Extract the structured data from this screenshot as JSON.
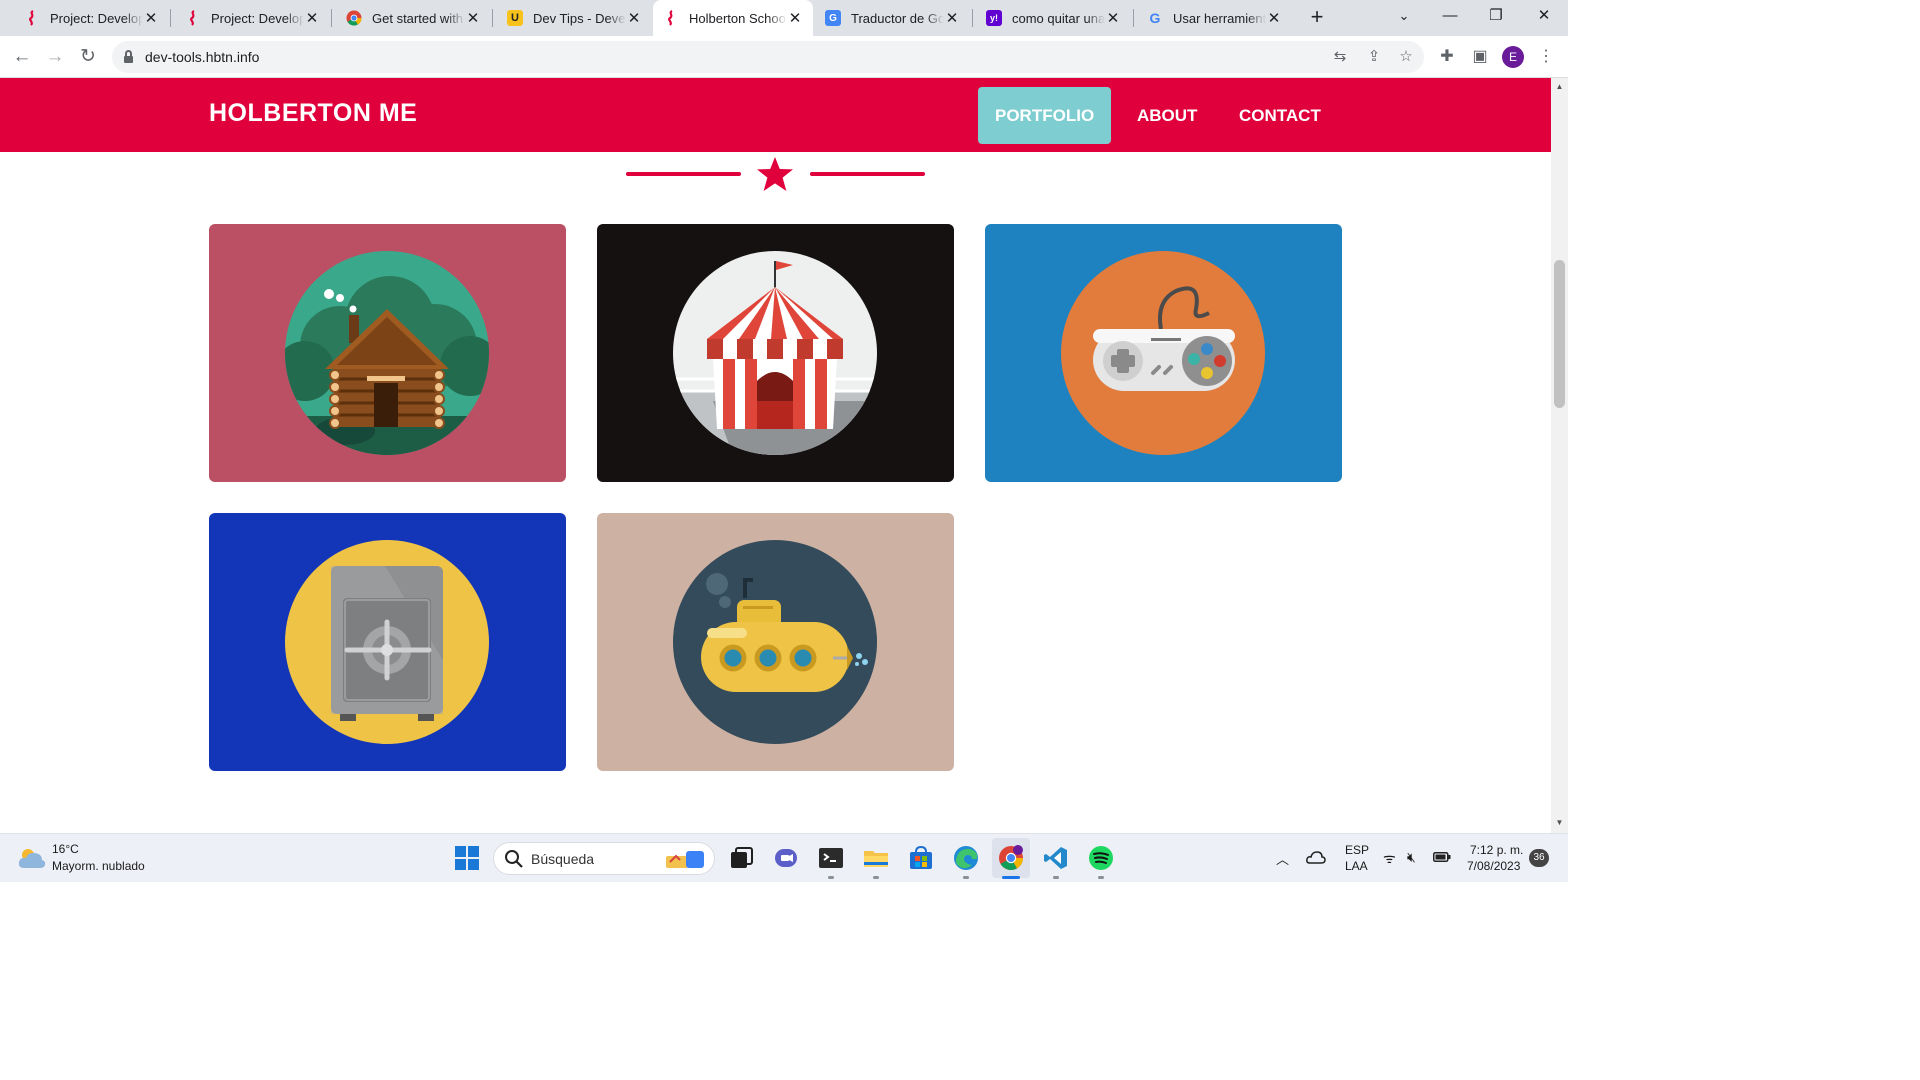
{
  "browser": {
    "tabs": [
      {
        "title": "Project: Developer tools",
        "favicon": "holberton-icon",
        "active": false
      },
      {
        "title": "Project: Developer tools",
        "favicon": "holberton-icon",
        "active": false
      },
      {
        "title": "Get started with viewing",
        "favicon": "chrome-icon",
        "active": false
      },
      {
        "title": "Dev Tips - Developer",
        "favicon": "dev-tips-icon",
        "active": false
      },
      {
        "title": "Holberton School",
        "favicon": "holberton-icon",
        "active": true
      },
      {
        "title": "Traductor de Google",
        "favicon": "google-translate-icon",
        "active": false
      },
      {
        "title": "como quitar una extension",
        "favicon": "yahoo-icon",
        "active": false
      },
      {
        "title": "Usar herramientas",
        "favicon": "google-icon",
        "active": false
      }
    ],
    "url": "dev-tools.hbtn.info",
    "profile_initial": "E"
  },
  "site": {
    "brand": "HOLBERTON ME",
    "nav": [
      {
        "label": "PORTFOLIO",
        "active": true
      },
      {
        "label": "ABOUT",
        "active": false
      },
      {
        "label": "CONTACT",
        "active": false
      }
    ],
    "accent_color": "#e0003c",
    "active_nav_color": "#7ecdd0",
    "portfolio": [
      {
        "icon": "log-cabin-icon",
        "bg": "#bb5065",
        "circle": "#2d7a5f"
      },
      {
        "icon": "circus-tent-icon",
        "bg": "#151111",
        "circle": "#eef0f0"
      },
      {
        "icon": "game-controller-icon",
        "bg": "#1e82c0",
        "circle": "#e17c3c"
      },
      {
        "icon": "safe-icon",
        "bg": "#1236b7",
        "circle": "#efc446"
      },
      {
        "icon": "submarine-icon",
        "bg": "#cdb1a3",
        "circle": "#334b5a"
      }
    ]
  },
  "taskbar": {
    "weather_temp": "16°C",
    "weather_desc": "Mayorm. nublado",
    "search_placeholder": "Búsqueda",
    "lang_top": "ESP",
    "lang_bottom": "LAA",
    "time": "7:12 p. m.",
    "date": "7/08/2023",
    "notifications": "36"
  }
}
